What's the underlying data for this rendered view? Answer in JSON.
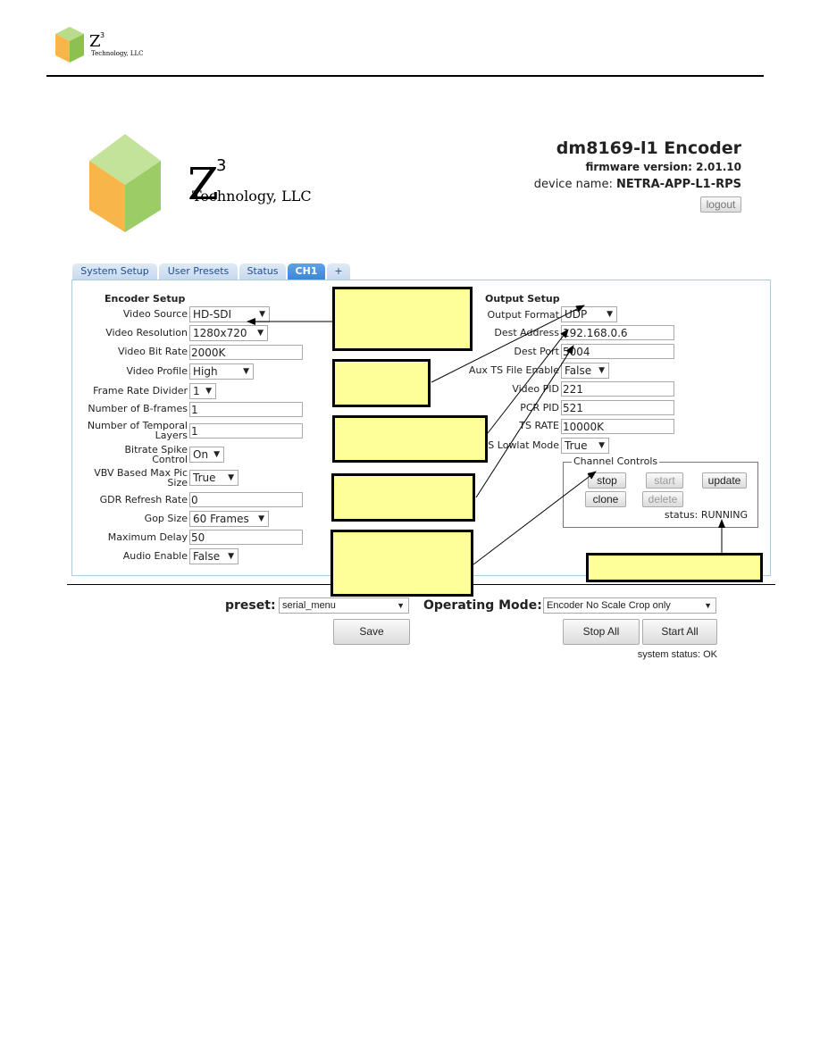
{
  "doc_header": {
    "logo_text": "Z3 Technology, LLC"
  },
  "app": {
    "logo_text": "Z3 Technology, LLC",
    "title": "dm8169-l1 Encoder",
    "firmware_label": "firmware version:",
    "firmware_value": "2.01.10",
    "device_label": "device name:",
    "device_value": "NETRA-APP-L1-RPS",
    "logout": "logout"
  },
  "tabs": [
    {
      "label": "System Setup"
    },
    {
      "label": "User Presets"
    },
    {
      "label": "Status"
    },
    {
      "label": "CH1",
      "active": true
    },
    {
      "label": "+"
    }
  ],
  "encoder": {
    "heading": "Encoder Setup",
    "video_source": {
      "label": "Video Source",
      "value": "HD-SDI"
    },
    "video_resolution": {
      "label": "Video Resolution",
      "value": "1280x720"
    },
    "video_bit_rate": {
      "label": "Video Bit Rate",
      "value": "2000K"
    },
    "video_profile": {
      "label": "Video Profile",
      "value": "High"
    },
    "frame_rate_divider": {
      "label": "Frame Rate Divider",
      "value": "1"
    },
    "b_frames": {
      "label": "Number of B-frames",
      "value": "1"
    },
    "temporal_layers": {
      "label1": "Number of Temporal",
      "label2": "Layers",
      "value": "1"
    },
    "bitrate_spike": {
      "label1": "Bitrate Spike",
      "label2": "Control",
      "value": "On"
    },
    "vbv": {
      "label1": "VBV Based Max Pic",
      "label2": "Size",
      "value": "True"
    },
    "gdr": {
      "label": "GDR Refresh Rate",
      "value": "0"
    },
    "gop": {
      "label": "Gop Size",
      "value": "60 Frames"
    },
    "max_delay": {
      "label": "Maximum Delay",
      "value": "50"
    },
    "audio": {
      "label": "Audio Enable",
      "value": "False"
    }
  },
  "output": {
    "heading": "Output Setup",
    "format": {
      "label": "Output Format",
      "value": "UDP"
    },
    "dest_address": {
      "label": "Dest Address",
      "value": "192.168.0.6"
    },
    "dest_port": {
      "label": "Dest Port",
      "value": "5004"
    },
    "aux_ts": {
      "label": "Aux TS File Enable",
      "value": "False"
    },
    "video_pid": {
      "label": "Video PID",
      "value": "221"
    },
    "pcr_pid": {
      "label": "PCR PID",
      "value": "521"
    },
    "ts_rate": {
      "label": "TS RATE",
      "value": "10000K"
    },
    "lowlat": {
      "label": "S Lowlat Mode",
      "value": "True"
    }
  },
  "channel_controls": {
    "legend": "Channel Controls",
    "stop": "stop",
    "start": "start",
    "update": "update",
    "clone": "clone",
    "delete": "delete",
    "status": "status: RUNNING"
  },
  "bottom": {
    "preset_label": "preset:",
    "preset_value": "serial_menu",
    "mode_label": "Operating Mode:",
    "mode_value": "Encoder No Scale Crop only",
    "save": "Save",
    "stop_all": "Stop All",
    "start_all": "Start All",
    "system_status": "system status: OK"
  },
  "colors": {
    "callout": "#ffff99",
    "tab_active": "#3b87d6",
    "panel_border": "#a8cbe0"
  }
}
